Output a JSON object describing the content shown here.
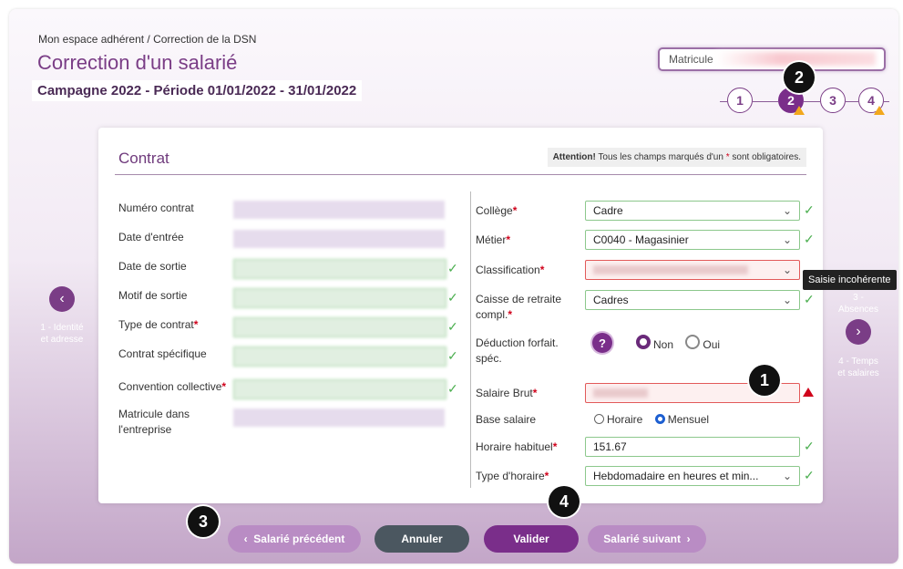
{
  "breadcrumb": "Mon espace adhérent / Correction de la DSN",
  "page_title": "Correction d'un salarié",
  "campaign": "Campagne 2022 - Période 01/01/2022 - 31/01/2022",
  "matricule_label": "Matricule",
  "steps": [
    "1",
    "2",
    "3",
    "4"
  ],
  "callouts": [
    "1",
    "2",
    "3",
    "4"
  ],
  "card": {
    "title": "Contrat",
    "notice_strong": "Attention!",
    "notice_pre": " Tous les champs marqués d'un ",
    "notice_star": "*",
    "notice_post": " sont obligatoires."
  },
  "left_fields": {
    "numero_contrat": "Numéro contrat",
    "date_entree": "Date d'entrée",
    "date_sortie": "Date de sortie",
    "motif_sortie": "Motif de sortie",
    "type_contrat": "Type de contrat",
    "contrat_specifique": "Contrat spécifique",
    "convention_collective": "Convention collective",
    "matricule_entreprise_1": "Matricule dans",
    "matricule_entreprise_2": "l'entreprise"
  },
  "right_fields": {
    "college_label": "Collège",
    "college_value": "Cadre",
    "metier_label": "Métier",
    "metier_value": "C0040 - Magasinier",
    "classification_label": "Classification",
    "caisse_label_1": "Caisse de retraite",
    "caisse_label_2": "compl.",
    "caisse_value": "Cadres",
    "deduction_label_1": "Déduction forfait.",
    "deduction_label_2": "spéc.",
    "non": "Non",
    "oui": "Oui",
    "salaire_label": "Salaire Brut",
    "base_label": "Base salaire",
    "horaire": "Horaire",
    "mensuel": "Mensuel",
    "horaire_habituel_label": "Horaire habituel",
    "horaire_habituel_value": "151.67",
    "type_horaire_label": "Type d'horaire",
    "type_horaire_value": "Hebdomadaire en heures et min..."
  },
  "req_star": "*",
  "tooltip": "Saisie incohérente",
  "left_nav": {
    "line1": "1 - Identité",
    "line2": "et adresse"
  },
  "right_nav": {
    "prev_line1": "3 -",
    "prev_line2": "Absences",
    "next_line1": "4 - Temps",
    "next_line2": "et salaires"
  },
  "buttons": {
    "prev": "Salarié précédent",
    "cancel": "Annuler",
    "validate": "Valider",
    "next": "Salarié suivant"
  },
  "colors": {
    "accent": "#7a2e8a",
    "valid": "#4caf50",
    "error": "#d0021b",
    "warning": "#f2a81d"
  }
}
